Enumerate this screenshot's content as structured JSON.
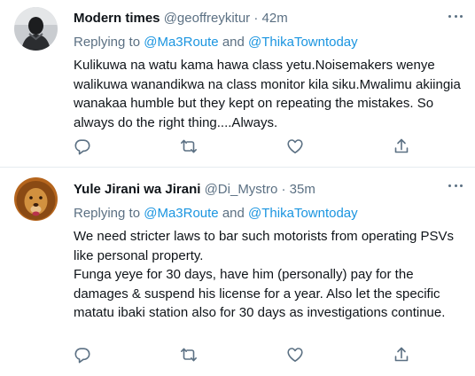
{
  "tweets": [
    {
      "name": "Modern times",
      "handle": "@geoffreykitur",
      "separator": "·",
      "time": "42m",
      "reply_prefix": "Replying to ",
      "mention1": "@Ma3Route",
      "reply_and": " and ",
      "mention2": "@ThikaTowntoday",
      "text": [
        "Kulikuwa na watu kama hawa class yetu.Noisemakers wenye walikuwa wanandikwa na class monitor kila siku.Mwalimu akiingia wanakaa humble but they kept on repeating the mistakes. So always do the right thing....Always."
      ],
      "avatar": "person-avatar"
    },
    {
      "name": "Yule Jirani wa Jirani",
      "handle": "@Di_Mystro",
      "separator": "·",
      "time": "35m",
      "reply_prefix": "Replying to ",
      "mention1": "@Ma3Route",
      "reply_and": " and ",
      "mention2": "@ThikaTowntoday",
      "text": [
        "We need stricter laws to bar such motorists from operating PSVs like personal property.",
        "Funga yeye for 30 days, have him (personally) pay for the damages & suspend his license for a year. Also let the specific matatu ibaki station also for 30 days as investigations continue."
      ],
      "avatar": "lion-avatar"
    }
  ],
  "icons": [
    "more-icon",
    "reply-icon",
    "retweet-icon",
    "like-icon",
    "share-icon"
  ],
  "colors": {
    "muted": "#5b7083",
    "link": "#1b95e0",
    "text": "#0f1419",
    "divider": "#e6ecf0"
  }
}
